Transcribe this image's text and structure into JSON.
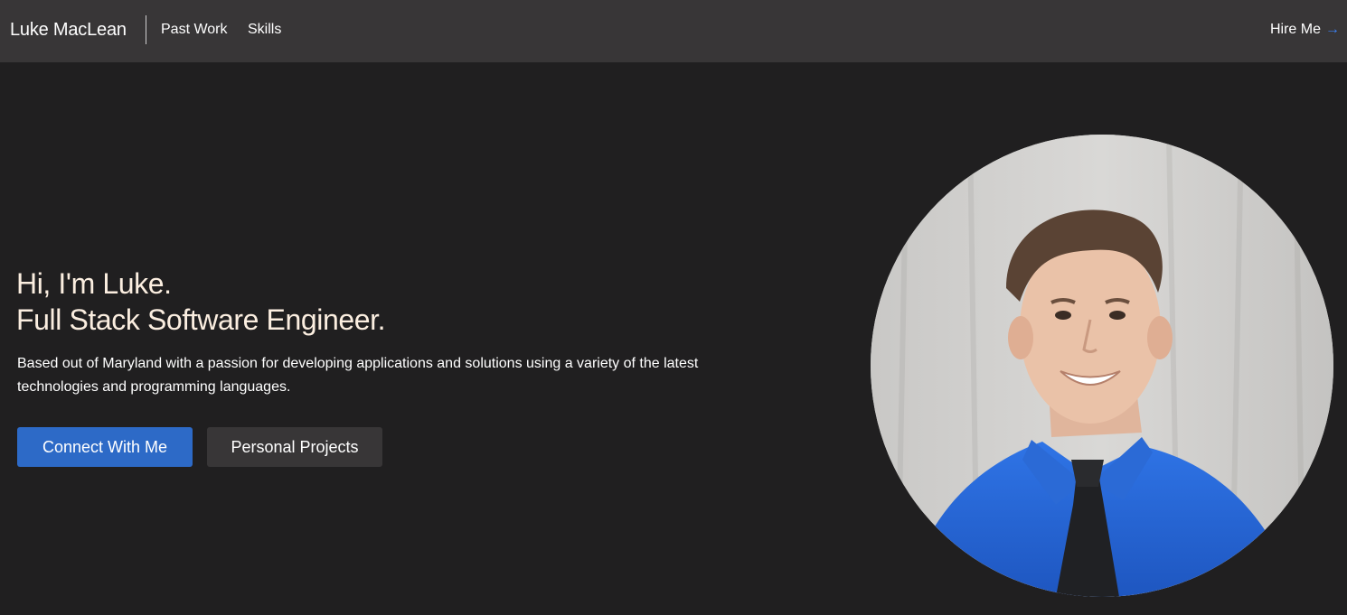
{
  "navbar": {
    "brand": "Luke MacLean",
    "links": [
      "Past Work",
      "Skills"
    ],
    "hire_label": "Hire Me",
    "hire_arrow": "→"
  },
  "hero": {
    "line1": "Hi, I'm Luke.",
    "line2": "Full Stack Software Engineer.",
    "description": "Based out of Maryland with a passion for developing applications and solutions using a variety of the latest technologies and programming languages.",
    "primary_button": "Connect With Me",
    "secondary_button": "Personal Projects"
  },
  "colors": {
    "background": "#201f20",
    "navbar": "#383637",
    "headline": "#fbeee0",
    "primary": "#2d6ac7",
    "accent_arrow": "#3b82f6",
    "shirt": "#2c6fe0"
  },
  "icons": {
    "hire_arrow": "arrow-right-icon"
  }
}
